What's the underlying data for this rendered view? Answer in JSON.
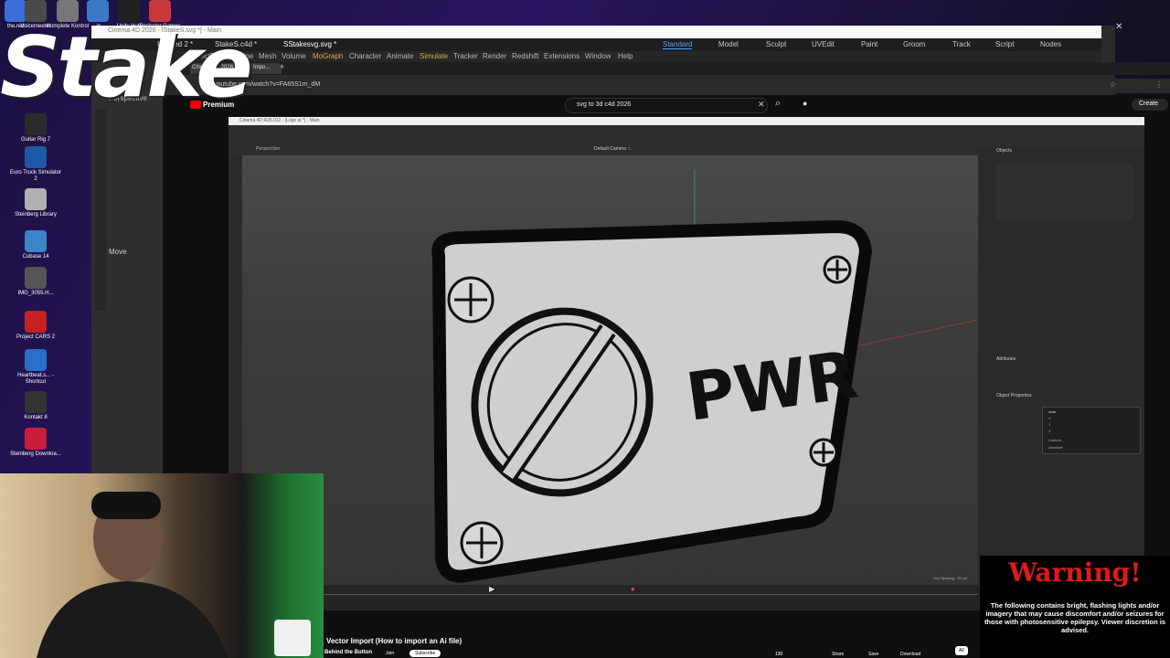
{
  "desktop": {
    "icons": [
      {
        "label": "the.net",
        "color": "#3a6fd8"
      },
      {
        "label": "Voicemeeter",
        "color": "#4a4a4a"
      },
      {
        "label": "Komplete Kontrol",
        "color": "#777777"
      },
      {
        "label": ".in",
        "color": "#3c78c8"
      },
      {
        "label": "Unity Hub",
        "color": "#222222"
      },
      {
        "label": "Rocketer Games",
        "color": "#c83a3a"
      },
      {
        "label": "Guitar Rig 7",
        "color": "#2a2a2a"
      },
      {
        "label": "Euro Truck Simulator 2",
        "color": "#1c5aa8"
      },
      {
        "label": "Steinberg Library",
        "color": "#b0b0b0"
      },
      {
        "label": "Cubase 14",
        "color": "#3a84c8"
      },
      {
        "label": "IMG_3055.H...",
        "color": "#555555"
      },
      {
        "label": "Project CARS 2",
        "color": "#c82020"
      },
      {
        "label": "Heartbeat.s... - Shortcut",
        "color": "#2a6fc8"
      },
      {
        "label": "Kontakt 8",
        "color": "#333333"
      },
      {
        "label": "Steinberg Downloa...",
        "color": "#c81e3c"
      }
    ]
  },
  "overlay": {
    "logo": "Stake"
  },
  "c4d_bg": {
    "title": "Cinema 4D 2026 - [StakeS.svg *] - Main",
    "tabs": [
      "Untitled 2 *",
      "StakeS.c4d *",
      "SStakesvg.svg *"
    ],
    "modes": [
      "Standard",
      "Model",
      "Sculpt",
      "UVEdit",
      "Paint",
      "Groom",
      "Track",
      "Script",
      "Nodes"
    ],
    "menu": [
      "Edit",
      "Select",
      "Tools",
      "Spline",
      "Mesh",
      "Volume",
      "MoGraph",
      "Character",
      "Animate",
      "Simulate",
      "Tracker",
      "Render",
      "Redshift",
      "Extensions",
      "Window",
      "Help"
    ],
    "viewport_label": "Perspective",
    "move_label": "Move"
  },
  "browser": {
    "tab_title": "Cinema 4D 2026: Vector Impo...",
    "url": "youtube.com/watch?v=FA65S1m_dM",
    "youtube_brand": "Premium",
    "search_value": "svg to 3d c4d 2026",
    "create_label": "Create",
    "video_title": "Vector Import (How to import an Ai file)",
    "channel": "Behind the Button",
    "join_label": "Join",
    "subscribe_label": "Subscribe",
    "likes": "130",
    "share_label": "Share",
    "save_label": "Save",
    "download_label": "Download",
    "all_label": "All"
  },
  "video": {
    "window_title": "Cinema 4D R26.012 - [Logo ai *] - Main",
    "viewport_label": "Perspective",
    "camera_label": "Default Camera ☆",
    "plate_text": "PWR",
    "grid_spacing": "Grid Spacing : 50 cm",
    "objects_header": "Objects",
    "attributes_header": "Attributes",
    "object_properties": "Object Properties",
    "dropdown_options": [
      "Auto",
      "X",
      "Y",
      "Z",
      "Custom",
      "Absolute"
    ]
  },
  "warning": {
    "title": "Warning!",
    "text": "The following contains bright, flashing lights and/or imagery that may cause discomfort and/or seizures for those with photosensitive epilepsy. Viewer discretion is advised."
  }
}
